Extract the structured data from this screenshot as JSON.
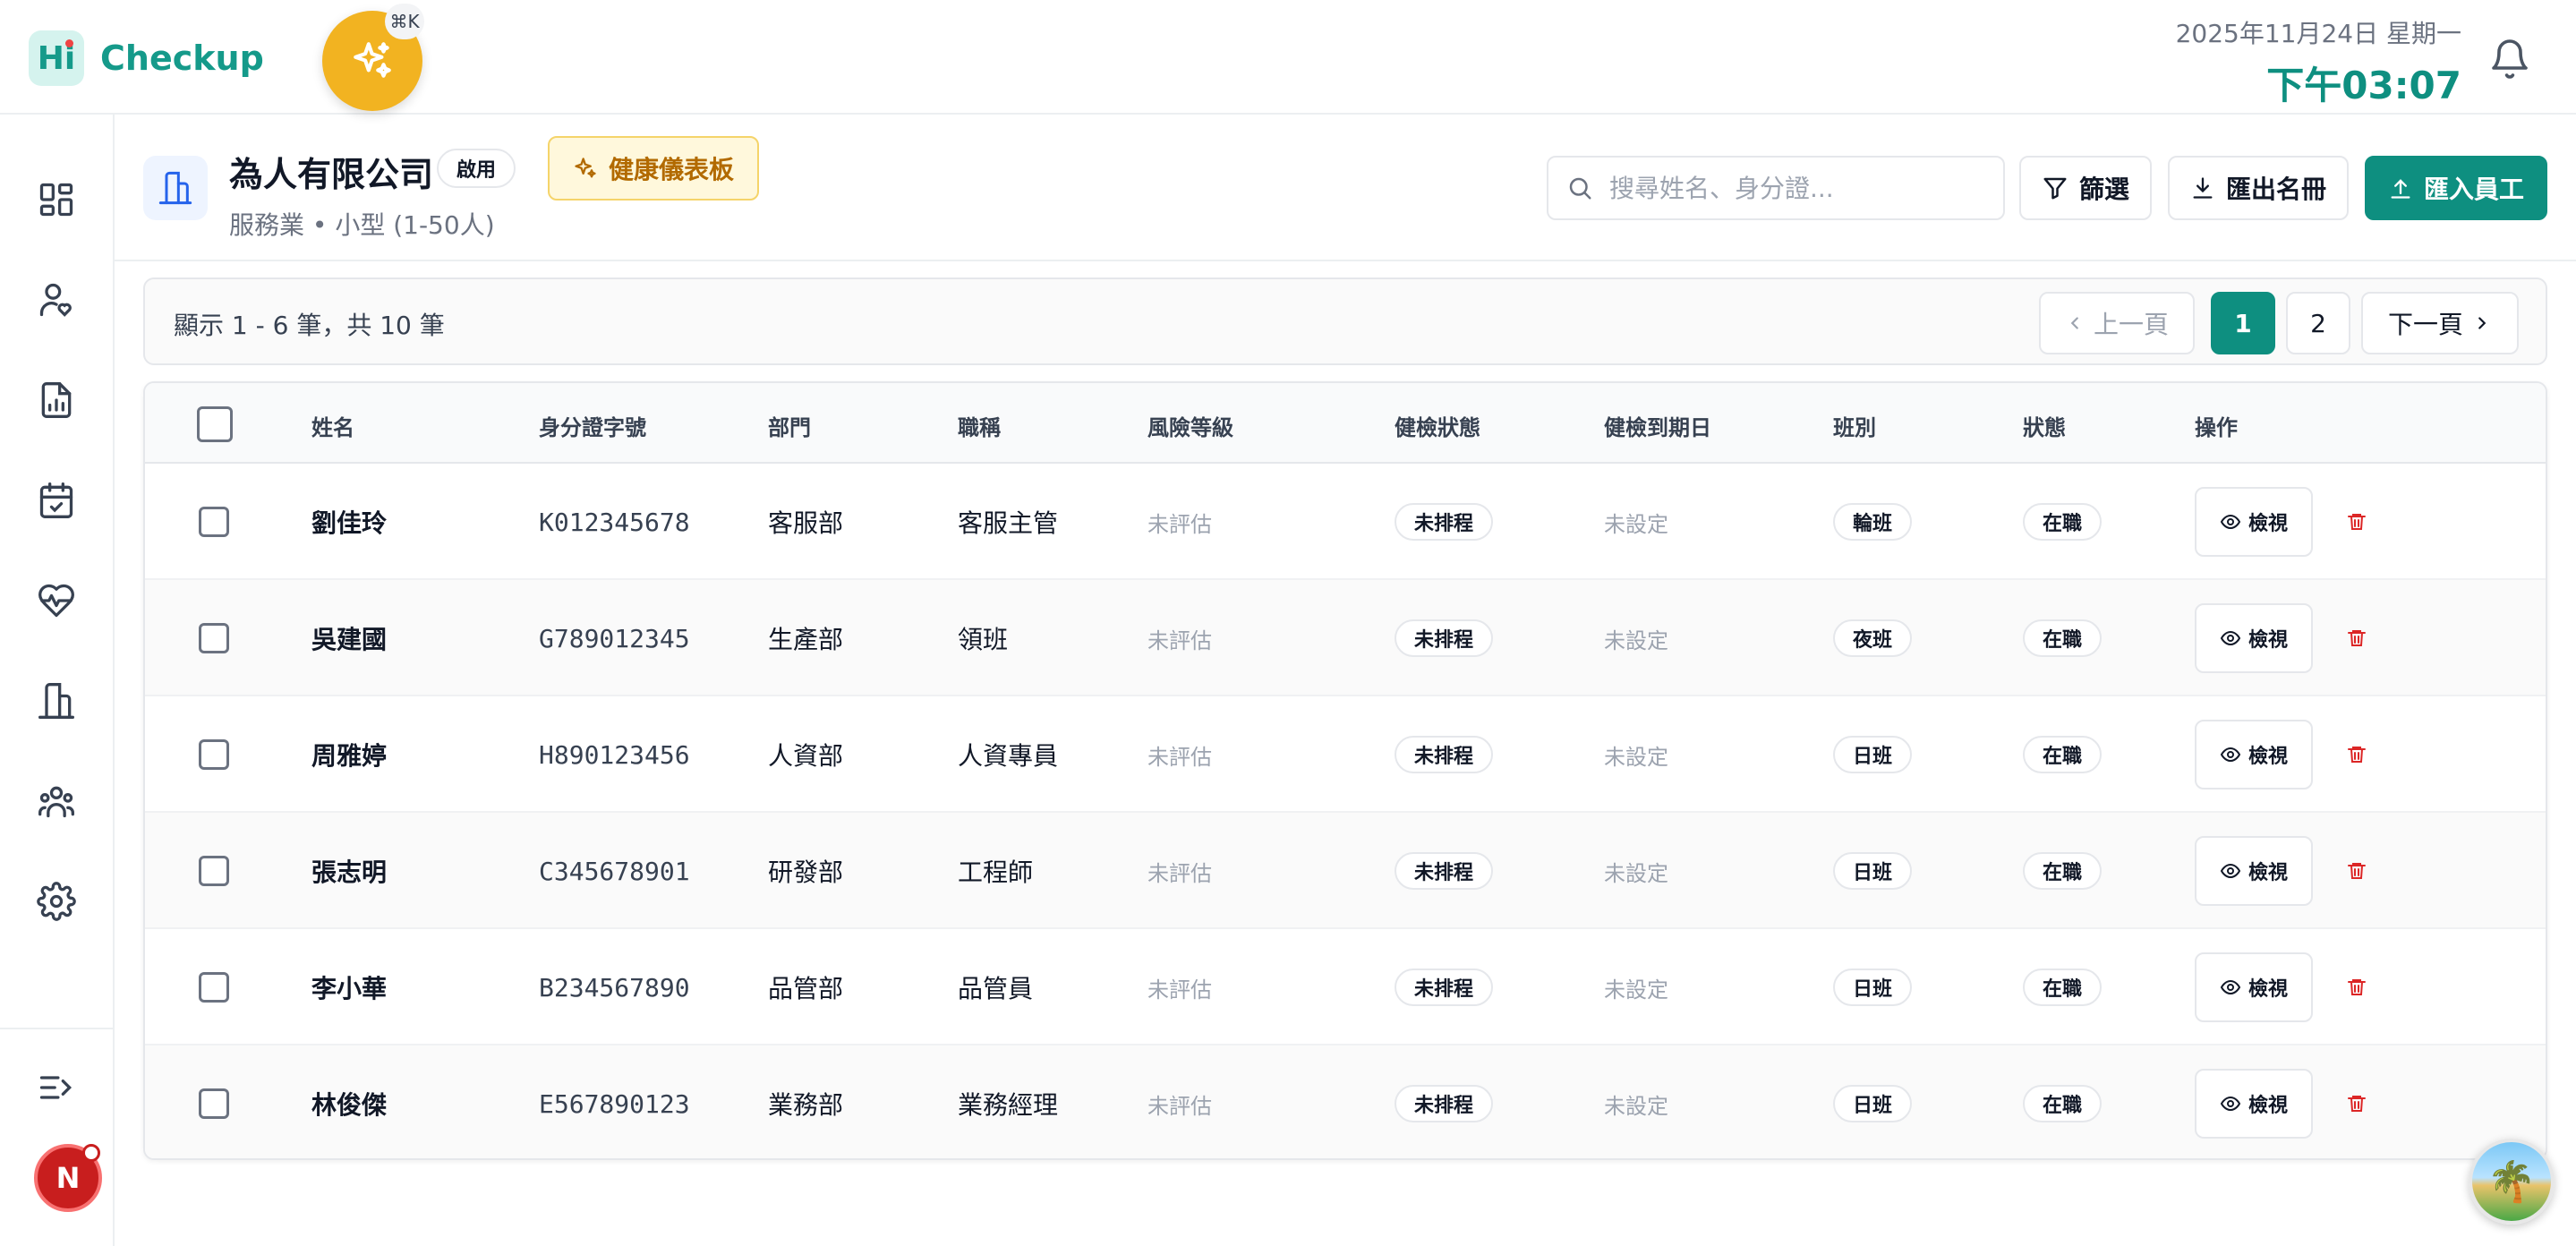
{
  "app": {
    "logo_mark": "Hi",
    "name": "Checkup",
    "shortcut": "⌘K"
  },
  "topbar": {
    "date": "2025年11月24日 星期一",
    "time": "下午03:07"
  },
  "sidebar": {
    "items": [
      "dashboard-icon",
      "health-user-icon",
      "report-icon",
      "calendar-check-icon",
      "heartbeat-icon",
      "building-icon",
      "team-icon",
      "settings-icon"
    ],
    "collapse_icon": "collapse-icon",
    "avatar_letter": "N"
  },
  "header": {
    "company_name": "為人有限公司",
    "status": "啟用",
    "dashboard_button": "健康儀表板",
    "subtitle": "服務業 • 小型 (1-50人)",
    "search_placeholder": "搜尋姓名、身分證...",
    "filter_button": "篩選",
    "export_button": "匯出名冊",
    "import_button": "匯入員工"
  },
  "pagination": {
    "range_text": "顯示 1 - 6 筆，共 10 筆",
    "prev": "上一頁",
    "pages": [
      "1",
      "2"
    ],
    "current_page": "1",
    "next": "下一頁"
  },
  "table": {
    "columns": [
      "姓名",
      "身分證字號",
      "部門",
      "職稱",
      "風險等級",
      "健檢狀態",
      "健檢到期日",
      "班別",
      "狀態",
      "操作"
    ],
    "view_label": "檢視",
    "rows": [
      {
        "name": "劉佳玲",
        "id": "K012345678",
        "dept": "客服部",
        "title": "客服主管",
        "risk": "未評估",
        "checkup": "未排程",
        "due": "未設定",
        "shift": "輪班",
        "status": "在職"
      },
      {
        "name": "吳建國",
        "id": "G789012345",
        "dept": "生產部",
        "title": "領班",
        "risk": "未評估",
        "checkup": "未排程",
        "due": "未設定",
        "shift": "夜班",
        "status": "在職"
      },
      {
        "name": "周雅婷",
        "id": "H890123456",
        "dept": "人資部",
        "title": "人資專員",
        "risk": "未評估",
        "checkup": "未排程",
        "due": "未設定",
        "shift": "日班",
        "status": "在職"
      },
      {
        "name": "張志明",
        "id": "C345678901",
        "dept": "研發部",
        "title": "工程師",
        "risk": "未評估",
        "checkup": "未排程",
        "due": "未設定",
        "shift": "日班",
        "status": "在職"
      },
      {
        "name": "李小華",
        "id": "B234567890",
        "dept": "品管部",
        "title": "品管員",
        "risk": "未評估",
        "checkup": "未排程",
        "due": "未設定",
        "shift": "日班",
        "status": "在職"
      },
      {
        "name": "林俊傑",
        "id": "E567890123",
        "dept": "業務部",
        "title": "業務經理",
        "risk": "未評估",
        "checkup": "未排程",
        "due": "未設定",
        "shift": "日班",
        "status": "在職"
      }
    ]
  },
  "colors": {
    "brand": "#0e8f80",
    "accent_yellow": "#f2b321",
    "danger": "#dc2626"
  }
}
